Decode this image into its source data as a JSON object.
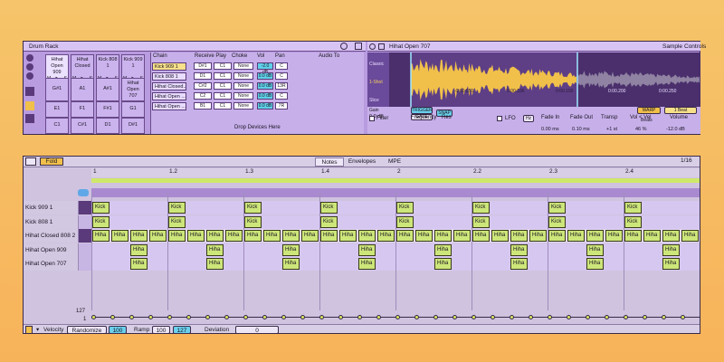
{
  "drum_rack": {
    "title": "Drum Rack",
    "pads_row1": [
      "Hihat Open 909",
      "Hihat Closed",
      "Kick 808 1",
      "Kick 909 1"
    ],
    "pads_row2": [
      "G#1",
      "A1",
      "A#1",
      "B1"
    ],
    "pads_row3": [
      "E1",
      "F1",
      "F#1",
      "G1"
    ],
    "pads_row4": [
      "C1",
      "C#1",
      "D1",
      "D#1"
    ],
    "pad_ctl": [
      "M",
      "▶",
      "S"
    ],
    "extra_pad": "Hihat Open 707",
    "chain_headers": [
      "Chain",
      "Receive Play",
      "Choke",
      "Vol",
      "Pan",
      "Audio To"
    ],
    "chains": [
      {
        "name": "Kick 909 1",
        "receive": "D#1",
        "play": "C1",
        "choke": "None",
        "vol": "-2.0 dB",
        "pan": "C"
      },
      {
        "name": "Kick 808 1",
        "receive": "D1",
        "play": "C1",
        "choke": "None",
        "vol": "0.0 dB",
        "pan": "C"
      },
      {
        "name": "Hihat Closed...",
        "receive": "C#2",
        "play": "C1",
        "choke": "None",
        "vol": "0.0 dB",
        "pan": "13R"
      },
      {
        "name": "Hihat Open ...",
        "receive": "C2",
        "play": "C1",
        "choke": "None",
        "vol": "0.0 dB",
        "pan": "C"
      },
      {
        "name": "Hihat Open ...",
        "receive": "B1",
        "play": "C1",
        "choke": "None",
        "vol": "0.0 dB",
        "pan": "7R"
      }
    ],
    "drop_hint": "Drop Devices Here"
  },
  "sample": {
    "title": "Hihat Open 707",
    "mode": "Sample",
    "controls_tab": "Controls",
    "side_labels": [
      "Classic",
      "1-Shot",
      "Slice"
    ],
    "gain_label": "Gain",
    "gain_value": "0.0 dB",
    "trigger": "TRIGGER",
    "gate": "GATE",
    "snap": "SNAP",
    "time_labels": [
      "-0:00.050",
      "0:00.100",
      "0:00.150",
      "0:00.200",
      "0:00.250"
    ],
    "warp": "WARP",
    "beats": "1 Beat",
    "filter_label": "Filter",
    "frequency": "Frequency",
    "res": "Res",
    "lfo": "LFO",
    "hz": "Hz",
    "fade_in": "Fade In",
    "fade_in_val": "0.00 ms",
    "fade_out": "Fade Out",
    "fade_out_val": "0.10 ms",
    "transp": "Transp",
    "transp_val": "+1 st",
    "vol_vel": "Vol < Vel",
    "vol_vel_val": "46 %",
    "volume": "Volume",
    "volume_val": "-12.0 dB",
    "beats_dropdown": "Beats"
  },
  "editor": {
    "fold": "Fold",
    "tabs": [
      "Notes",
      "Envelopes",
      "MPE"
    ],
    "grid": "1/16",
    "ruler": [
      "1",
      "1.2",
      "1.3",
      "1.4",
      "2",
      "2.2",
      "2.3",
      "2.4"
    ],
    "rows": [
      {
        "name": "Kick 909 1"
      },
      {
        "name": "Kick 808 1"
      },
      {
        "name": "Hihat Closed 808 2"
      },
      {
        "name": "Hihat Open 909"
      },
      {
        "name": "Hihat Open 707"
      }
    ],
    "note_kick": "Kick",
    "note_hiha": "Hiha",
    "vel_top": "127",
    "vel_bottom": "1",
    "velocity": "Velocity",
    "randomize": "Randomize",
    "rand_val": "100",
    "ramp": "Ramp",
    "ramp_a": "100",
    "ramp_b": "127",
    "deviation": "Deviation",
    "dev_val": "0"
  },
  "colors": {
    "accent": "#b99be0",
    "note": "#cde67a",
    "loop": "#cfe86a",
    "wave": "#f0c04a"
  }
}
